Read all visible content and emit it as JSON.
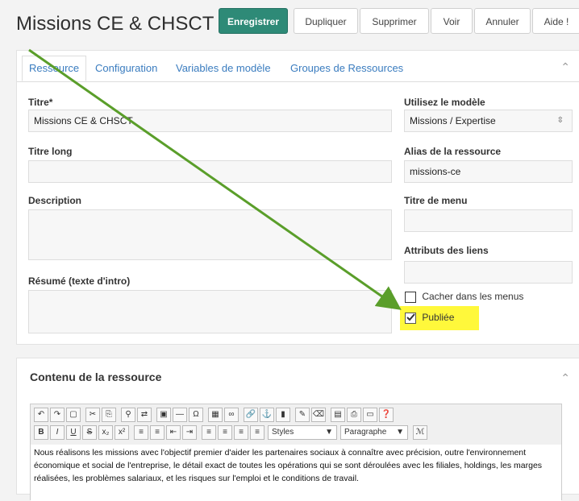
{
  "header": {
    "title": "Missions CE & CHSCT",
    "buttons": {
      "save": "Enregistrer",
      "duplicate": "Dupliquer",
      "delete": "Supprimer",
      "view": "Voir",
      "cancel": "Annuler",
      "help": "Aide !"
    }
  },
  "tabs": [
    "Ressource",
    "Configuration",
    "Variables de modèle",
    "Groupes de Ressources"
  ],
  "form": {
    "titre_label": "Titre*",
    "titre_value": "Missions CE & CHSCT",
    "titre_long_label": "Titre long",
    "titre_long_value": "",
    "description_label": "Description",
    "description_value": "",
    "resume_label": "Résumé (texte d'intro)",
    "resume_value": "",
    "modele_label": "Utilisez le modèle",
    "modele_value": "Missions / Expertise",
    "alias_label": "Alias de la ressource",
    "alias_value": "missions-ce",
    "menu_title_label": "Titre de menu",
    "menu_title_value": "",
    "link_attr_label": "Attributs des liens",
    "link_attr_value": "",
    "hide_menu_label": "Cacher dans les menus",
    "hide_menu_checked": false,
    "published_label": "Publiée",
    "published_checked": true
  },
  "content_panel": {
    "title": "Contenu de la ressource",
    "styles_label": "Styles",
    "format_label": "Paragraphe",
    "text": "Nous réalisons les missions avec l'objectif premier d'aider les partenaires sociaux à connaître avec précision, outre l'environnement économique et social de l'entreprise, le détail exact de toutes les opérations qui se sont déroulées avec les filiales, holdings, les marges réalisées, les problèmes salariaux, et les risques sur l'emploi et le conditions de travail."
  },
  "colors": {
    "primary": "#2e8a77",
    "tab_link": "#3a7cbf",
    "highlight": "#fff83b",
    "arrow": "#5a9e2a"
  }
}
